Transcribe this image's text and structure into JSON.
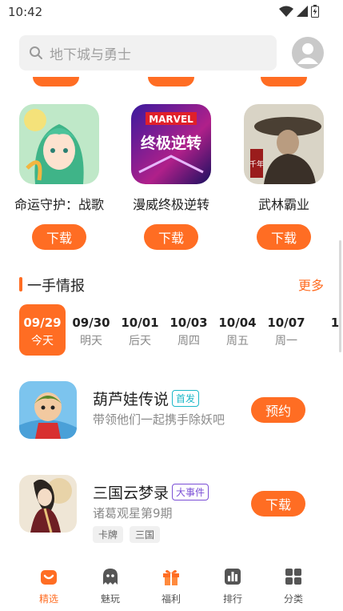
{
  "status": {
    "time": "10:42"
  },
  "search": {
    "placeholder": "地下城与勇士"
  },
  "featured_games": [
    {
      "name": "命运守护：战歌",
      "button": "下载",
      "icon": "green-haired-elf-game-icon"
    },
    {
      "name": "漫威终极逆转",
      "button": "下载",
      "icon": "marvel-snap-game-icon",
      "icon_text_top": "MARVEL",
      "icon_text_main": "终极逆转"
    },
    {
      "name": "武林霸业",
      "button": "下载",
      "icon": "wuxia-swordsman-game-icon",
      "icon_text": "千年"
    }
  ],
  "section": {
    "title": "一手情报",
    "more": "更多"
  },
  "dates": [
    {
      "date": "09/29",
      "weekday": "今天",
      "active": true
    },
    {
      "date": "09/30",
      "weekday": "明天"
    },
    {
      "date": "10/01",
      "weekday": "后天"
    },
    {
      "date": "10/03",
      "weekday": "周四"
    },
    {
      "date": "10/04",
      "weekday": "周五"
    },
    {
      "date": "10/07",
      "weekday": "周一"
    },
    {
      "date": "1",
      "weekday": ""
    }
  ],
  "events": [
    {
      "title": "葫芦娃传说",
      "tag": "首发",
      "tag_color": "#1cb8c8",
      "desc": "带领他们一起携手除妖吧",
      "button": "预约",
      "chips": [],
      "icon": "calabash-brothers-game-icon"
    },
    {
      "title": "三国云梦录",
      "tag": "大事件",
      "tag_color": "#7b4fd6",
      "desc": "诸葛观星第9期",
      "button": "下载",
      "chips": [
        "卡牌",
        "三国"
      ],
      "icon": "three-kingdoms-lady-game-icon"
    }
  ],
  "tabs": [
    {
      "label": "精选",
      "icon": "featured-icon",
      "active": true
    },
    {
      "label": "魅玩",
      "icon": "ghost-icon"
    },
    {
      "label": "福利",
      "icon": "gift-icon"
    },
    {
      "label": "排行",
      "icon": "ranking-icon"
    },
    {
      "label": "分类",
      "icon": "category-grid-icon"
    }
  ],
  "colors": {
    "accent": "#ff6d23",
    "text": "#222222",
    "muted": "#8a8a8a"
  }
}
